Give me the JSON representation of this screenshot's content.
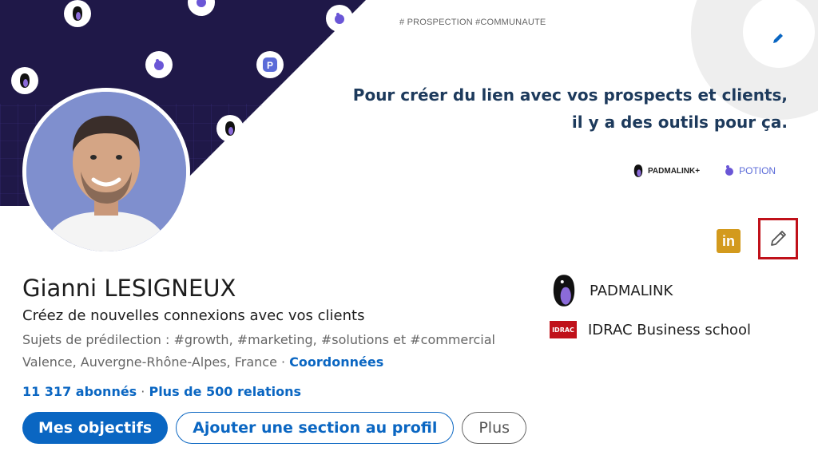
{
  "banner": {
    "tags": "# PROSPECTION  #COMMUNAUTE",
    "tagline_line1": "Pour créer du lien avec vos prospects et clients,",
    "tagline_line2": "il y a des outils pour ça.",
    "brand1": "PADMALINK+",
    "brand2": "POTION",
    "colors": {
      "dark": "#1f1848",
      "grid": "#4a3ea6"
    }
  },
  "profile": {
    "name": "Gianni LESIGNEUX",
    "headline": "Créez de nouvelles connexions avec vos clients",
    "topics": "Sujets de prédilection : #growth, #marketing, #solutions et #commercial",
    "location": "Valence, Auvergne-Rhône-Alpes, France · ",
    "contact_link": "Coordonnées",
    "followers": "11 317 abonnés",
    "separator": " · ",
    "connections": "Plus de 500 relations"
  },
  "actions": {
    "primary": "Mes objectifs",
    "add_section": "Ajouter une section au profil",
    "more": "Plus"
  },
  "orgs": [
    {
      "name": "PADMALINK",
      "icon": "penguin-logo-icon"
    },
    {
      "name": "IDRAC Business school",
      "icon": "idrac-logo-icon",
      "logo_text": "IDRAC"
    }
  ],
  "icons": {
    "linkedin_label": "in",
    "accent": "#0a66c2",
    "highlight": "#c0111a"
  }
}
